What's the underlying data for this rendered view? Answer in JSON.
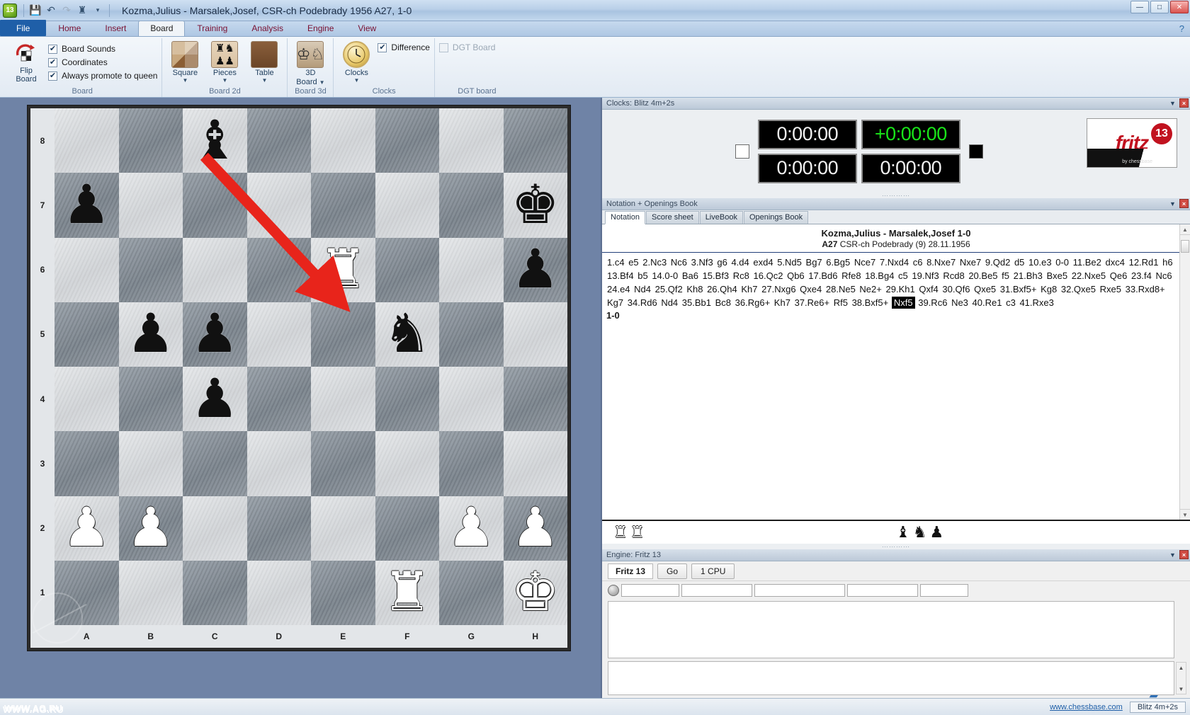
{
  "window": {
    "title": "Kozma,Julius - Marsalek,Josef, CSR-ch Podebrady 1956  A27, 1-0",
    "logo_text": "13",
    "minimize": "—",
    "maximize": "□",
    "close": "✕",
    "quick_access": [
      "save-icon",
      "undo-icon",
      "redo-icon",
      "chessboard-icon",
      "dropdown-icon"
    ]
  },
  "ribbon": {
    "tabs": [
      {
        "label": "File",
        "active": false,
        "file": true
      },
      {
        "label": "Home",
        "active": false
      },
      {
        "label": "Insert",
        "active": false
      },
      {
        "label": "Board",
        "active": true
      },
      {
        "label": "Training",
        "active": false
      },
      {
        "label": "Analysis",
        "active": false
      },
      {
        "label": "Engine",
        "active": false
      },
      {
        "label": "View",
        "active": false
      }
    ],
    "help": "?",
    "groups": [
      {
        "title": "Board",
        "flip_label_1": "Flip",
        "flip_label_2": "Board",
        "checks": [
          {
            "label": "Board Sounds",
            "checked": true,
            "enabled": true
          },
          {
            "label": "Coordinates",
            "checked": true,
            "enabled": true
          },
          {
            "label": "Always promote to queen",
            "checked": true,
            "enabled": true
          }
        ]
      },
      {
        "title": "Board 2d",
        "tiles": [
          {
            "label": "Square",
            "icon": "square-texture-icon"
          },
          {
            "label": "Pieces",
            "icon": "pieces-set-icon"
          },
          {
            "label": "Table",
            "icon": "table-texture-icon"
          }
        ]
      },
      {
        "title": "Board 3d",
        "tiles": [
          {
            "label_1": "3D",
            "label_2": "Board",
            "icon": "3d-board-icon"
          }
        ]
      },
      {
        "title": "Clocks",
        "tiles": [
          {
            "label": "Clocks",
            "icon": "analog-clock-icon"
          }
        ],
        "checks": [
          {
            "label": "Difference",
            "checked": true,
            "enabled": true
          }
        ]
      },
      {
        "title": "DGT board",
        "checks": [
          {
            "label": "DGT Board",
            "checked": false,
            "enabled": false
          }
        ]
      }
    ]
  },
  "board": {
    "files": [
      "A",
      "B",
      "C",
      "D",
      "E",
      "F",
      "G",
      "H"
    ],
    "ranks": [
      "8",
      "7",
      "6",
      "5",
      "4",
      "3",
      "2",
      "1"
    ],
    "squares": [
      [
        null,
        null,
        "bb",
        null,
        null,
        null,
        null,
        null
      ],
      [
        "bp",
        null,
        null,
        null,
        null,
        null,
        null,
        "bk"
      ],
      [
        null,
        null,
        null,
        null,
        "wr",
        null,
        null,
        "bp"
      ],
      [
        null,
        "bp",
        "bp",
        null,
        null,
        "bn",
        null,
        null
      ],
      [
        null,
        null,
        "bp",
        null,
        null,
        null,
        null,
        null
      ],
      [
        null,
        null,
        null,
        null,
        null,
        null,
        null,
        null
      ],
      [
        "wp",
        "wp",
        null,
        null,
        null,
        null,
        "wp",
        "wp"
      ],
      [
        null,
        null,
        null,
        null,
        null,
        "wr",
        null,
        "wk"
      ]
    ],
    "arrow": {
      "from": "C8",
      "to": "E6",
      "color": "#e8241b"
    },
    "watermark": "ag-circle-logo",
    "site_text": "WWW.AG.RU"
  },
  "clocks": {
    "panel_title": "Clocks: Blitz 4m+2s",
    "white_indicator": "white",
    "black_indicator": "black",
    "cells": [
      {
        "value": "0:00:00",
        "green": false
      },
      {
        "value": "+0:00:00",
        "green": true
      },
      {
        "value": "0:00:00",
        "green": false
      },
      {
        "value": "0:00:00",
        "green": false
      }
    ],
    "logo": {
      "word": "fritz",
      "number": "13",
      "sub": "by chessbase"
    }
  },
  "notation": {
    "panel_title": "Notation + Openings Book",
    "tabs": [
      {
        "label": "Notation",
        "active": true
      },
      {
        "label": "Score sheet",
        "active": false
      },
      {
        "label": "LiveBook",
        "active": false
      },
      {
        "label": "Openings Book",
        "active": false
      }
    ],
    "game_title": "Kozma,Julius - Marsalek,Josef  1-0",
    "eco": "A27",
    "event": "CSR-ch Podebrady (9) 28.11.1956",
    "moves": [
      "1.c4",
      "e5",
      "2.Nc3",
      "Nc6",
      "3.Nf3",
      "g6",
      "4.d4",
      "exd4",
      "5.Nd5",
      "Bg7",
      "6.Bg5",
      "Nce7",
      "7.Nxd4",
      "c6",
      "8.Nxe7",
      "Nxe7",
      "9.Qd2",
      "d5",
      "10.e3",
      "0-0",
      "11.Be2",
      "dxc4",
      "12.Rd1",
      "h6",
      "13.Bf4",
      "b5",
      "14.0-0",
      "Ba6",
      "15.Bf3",
      "Rc8",
      "16.Qc2",
      "Qb6",
      "17.Bd6",
      "Rfe8",
      "18.Bg4",
      "c5",
      "19.Nf3",
      "Rcd8",
      "20.Be5",
      "f5",
      "21.Bh3",
      "Bxe5",
      "22.Nxe5",
      "Qe6",
      "23.f4",
      "Nc6",
      "24.e4",
      "Nd4",
      "25.Qf2",
      "Kh8",
      "26.Qh4",
      "Kh7",
      "27.Nxg6",
      "Qxe4",
      "28.Ne5",
      "Ne2+",
      "29.Kh1",
      "Qxf4",
      "30.Qf6",
      "Qxe5",
      "31.Bxf5+",
      "Kg8",
      "32.Qxe5",
      "Rxe5",
      "33.Rxd8+",
      "Kg7",
      "34.Rd6",
      "Nd4",
      "35.Bb1",
      "Bc8",
      "36.Rg6+",
      "Kh7",
      "37.Re6+",
      "Rf5",
      "38.Bxf5+",
      "Nxf5",
      "39.Rc6",
      "Ne3",
      "40.Re1",
      "c3",
      "41.Rxe3"
    ],
    "highlighted_move": "Nxf5",
    "result": "1-0"
  },
  "material": {
    "white_pieces": [
      "rook",
      "rook"
    ],
    "black_pieces": [
      "bishop",
      "knight",
      "pawn"
    ]
  },
  "engine": {
    "panel_title": "Engine: Fritz 13",
    "name": "Fritz 13",
    "go_label": "Go",
    "cpu_label": "1 CPU",
    "fields": [
      "",
      "",
      "",
      "",
      ""
    ],
    "output": "",
    "next_arrow": "❯"
  },
  "statusbar": {
    "link": "www.chessbase.com",
    "mode": "Blitz 4m+2s",
    "site": "WWW.AG.RU"
  }
}
